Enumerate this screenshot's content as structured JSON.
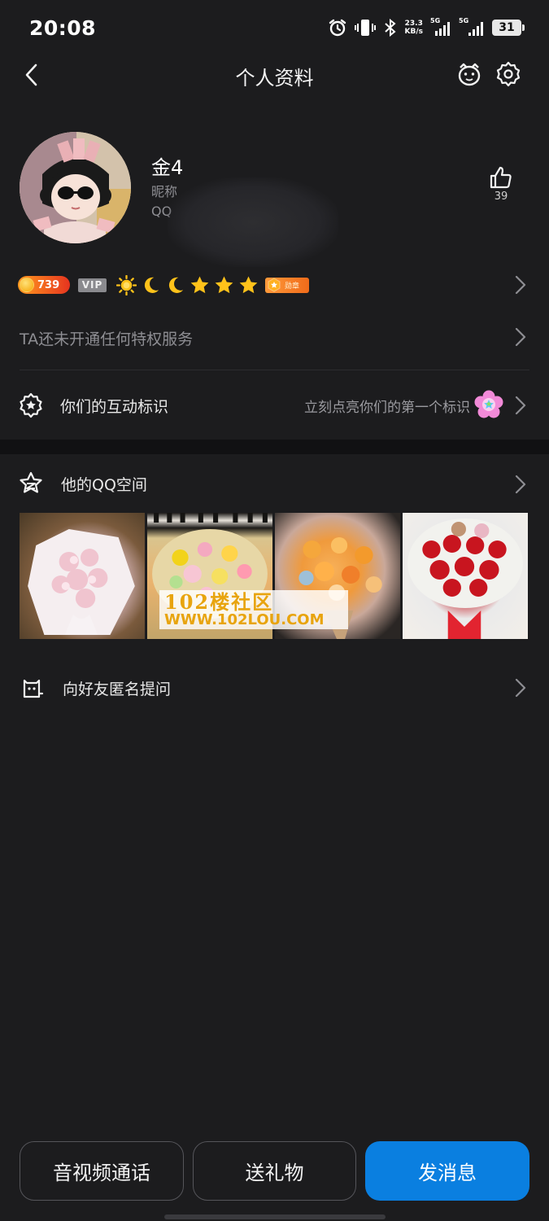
{
  "status_bar": {
    "time": "20:08",
    "speed_value": "23.3",
    "speed_unit": "KB/s",
    "net1_label": "5G",
    "net2_label": "5G",
    "battery": "31"
  },
  "nav": {
    "title": "个人资料"
  },
  "profile": {
    "name": "金4",
    "nickname_label": "昵称",
    "qq_label": "QQ",
    "like_count": "39"
  },
  "badges": {
    "level_number": "739",
    "vip_label": "VIP",
    "medal_label": "勋章"
  },
  "rows": {
    "privilege": "TA还未开通任何特权服务",
    "interaction_label": "你们的互动标识",
    "interaction_hint": "立刻点亮你们的第一个标识",
    "qzone_label": "他的QQ空间",
    "ask_label": "向好友匿名提问"
  },
  "watermark": {
    "line1": "102楼社区",
    "line2": "WWW.102LOU.COM"
  },
  "buttons": {
    "call": "音视频通话",
    "gift": "送礼物",
    "message": "发消息"
  },
  "colors": {
    "background": "#1c1c1e",
    "primary_button": "#0a7fe0",
    "secondary_text": "#8e8e93"
  }
}
